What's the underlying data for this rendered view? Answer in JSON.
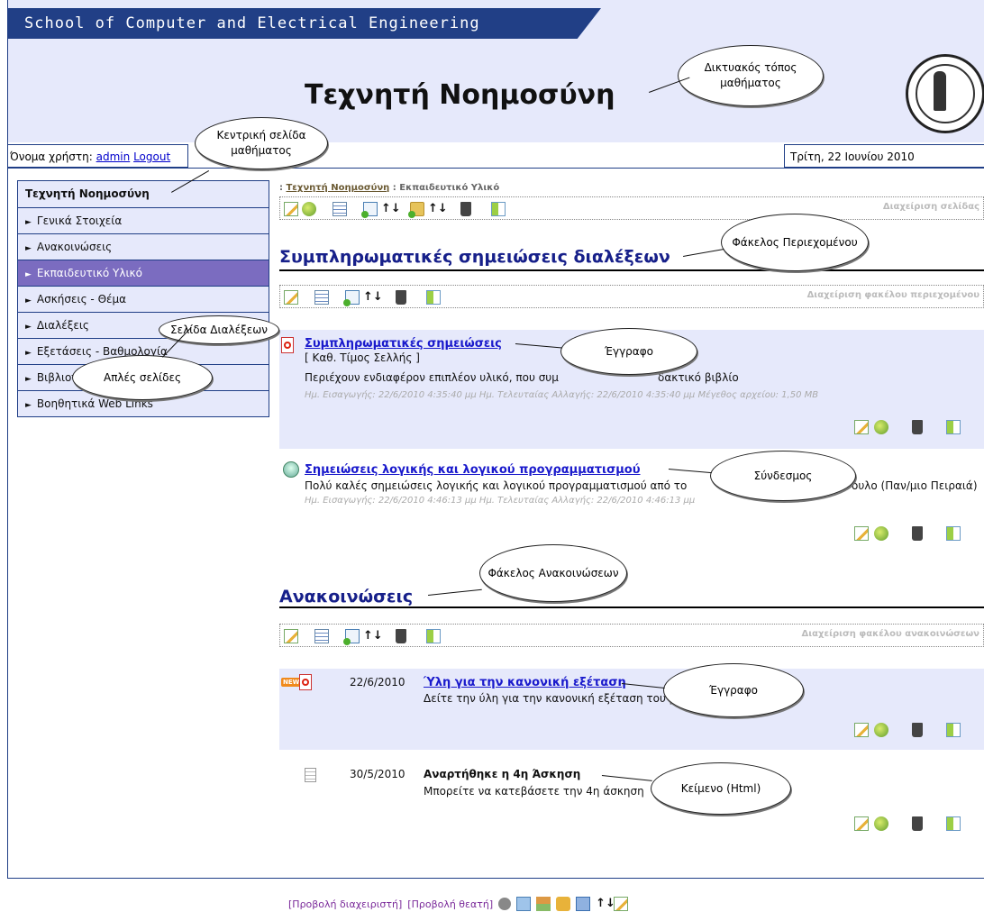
{
  "header": {
    "school": "School of Computer and Electrical Engineering",
    "course_title": "Τεχνητή Νοημοσύνη"
  },
  "user": {
    "label": "Όνομα χρήστη:",
    "username": "admin",
    "logout": "Logout"
  },
  "date": "Τρίτη, 22 Ιουνίου 2010",
  "sidebar": {
    "items": [
      {
        "label": "Τεχνητή Νοημοσύνη"
      },
      {
        "label": "Γενικά Στοιχεία"
      },
      {
        "label": "Ανακοινώσεις"
      },
      {
        "label": "Εκπαιδευτικό Υλικό"
      },
      {
        "label": "Ασκήσεις - Θέμα"
      },
      {
        "label": "Διαλέξεις"
      },
      {
        "label": "Εξετάσεις - Βαθμολογία"
      },
      {
        "label": "Βιβλιογραφία και Συγγράματα"
      },
      {
        "label": "Βοηθητικά Web Links"
      }
    ],
    "active_index": 3
  },
  "breadcrumb": {
    "sep": ":",
    "course": "Τεχνητή Νοημοσύνη",
    "page": "Εκπαιδευτικό Υλικό"
  },
  "page_toolbar": {
    "label": "Διαχείριση σελίδας"
  },
  "folder1": {
    "title": "Συμπληρωματικές σημειώσεις διαλέξεων",
    "toolbar_label": "Διαχείριση φακέλου περιεχομένου",
    "items": [
      {
        "title": "Συμπληρωματικές σημειώσεις",
        "author": "[ Καθ. Τίμος Σελλής ]",
        "desc": "Περιέχουν ενδιαφέρον επιπλέον υλικό, που συμ",
        "desc_tail": "δακτικό βιβλίο",
        "meta": "Ημ. Εισαγωγής: 22/6/2010 4:35:40 μμ Ημ. Τελευταίας Αλλαγής: 22/6/2010 4:35:40 μμ Μέγεθος αρχείου: 1,50 MB"
      },
      {
        "title": "Σημειώσεις λογικής και λογικού προγραμματισμού",
        "desc": "Πολύ καλές σημειώσεις λογικής και λογικού προγραμματισμού από το",
        "desc_tail": "ουλο (Παν/μιο Πειραιά)",
        "meta": "Ημ. Εισαγωγής: 22/6/2010 4:46:13 μμ Ημ. Τελευταίας Αλλαγής: 22/6/2010 4:46:13 μμ"
      }
    ]
  },
  "folder2": {
    "title": "Ανακοινώσεις",
    "toolbar_label": "Διαχείριση φακέλου ανακοινώσεων",
    "items": [
      {
        "badge": "NEW",
        "date": "22/6/2010",
        "title": "Ύλη για την κανονική εξέταση",
        "desc": "Δείτε την ύλη για την κανονική εξέταση του μ"
      },
      {
        "date": "30/5/2010",
        "title": "Αναρτήθηκε η 4η Άσκηση",
        "desc": "Μπορείτε να κατεβάσετε την 4η άσκηση"
      }
    ]
  },
  "callouts": {
    "site": "Δικτυακός τόπος μαθήματος",
    "home": "Κεντρική σελίδα μαθήματος",
    "lectures_page": "Σελίδα Διαλέξεων",
    "simple_pages": "Απλές σελίδες",
    "content_folder": "Φάκελος Περιεχομένου",
    "document1": "Έγγραφο",
    "link": "Σύνδεσμος",
    "announce_folder": "Φάκελος Ανακοινώσεων",
    "document2": "Έγγραφο",
    "html_text": "Κείμενο (Html)"
  },
  "footer": {
    "admin_view": "[Προβολή διαχειριστή]",
    "viewer_view": "[Προβολή θεατή]"
  },
  "colors": {
    "brand_blue": "#213f86",
    "header_bg": "#e6e9fb",
    "active_item": "#7b6cc0",
    "section_title": "#17208a"
  }
}
